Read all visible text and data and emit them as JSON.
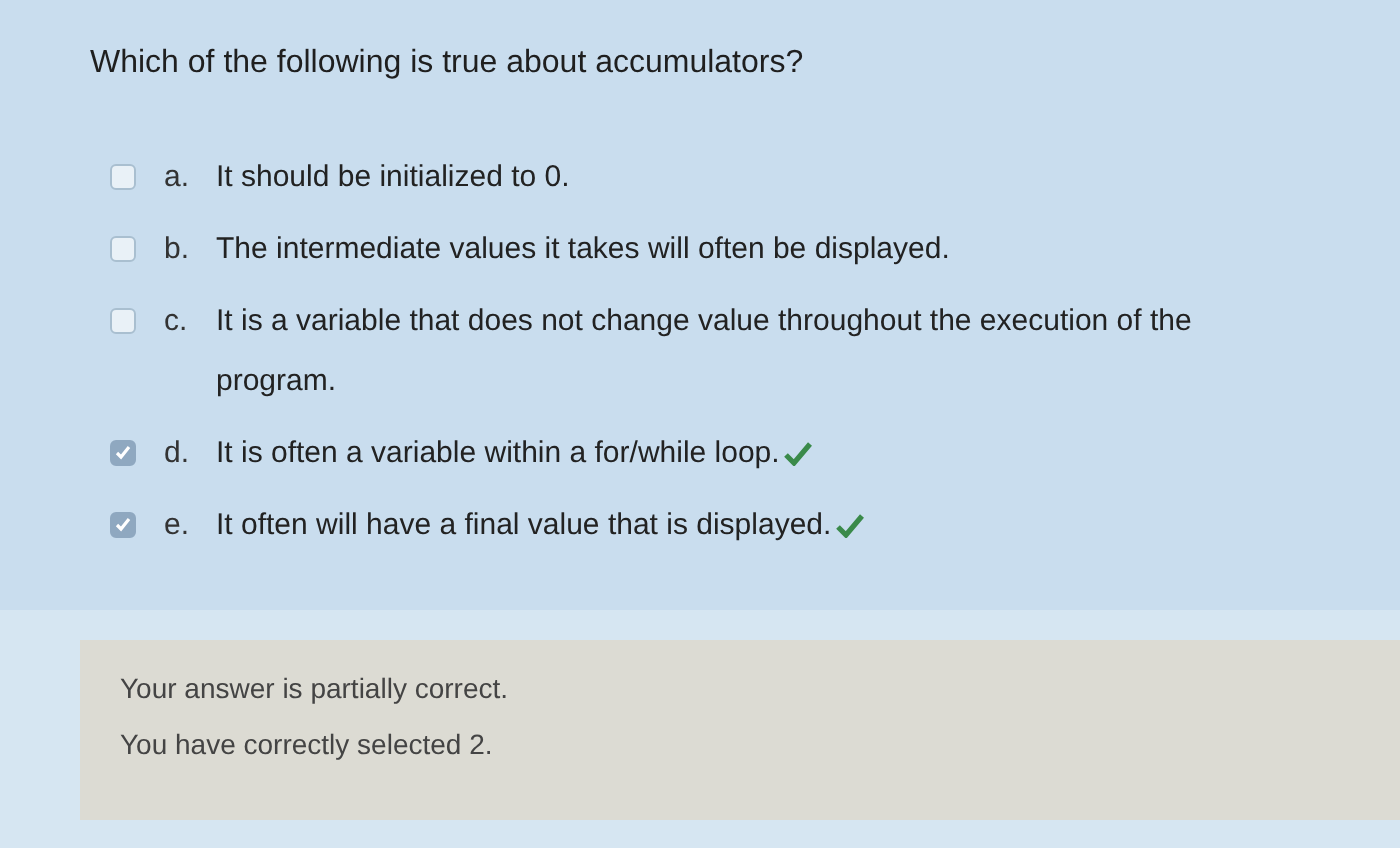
{
  "question": "Which of the following is true about accumulators?",
  "options": [
    {
      "letter": "a.",
      "text": "It should be initialized to 0.",
      "checked": false,
      "correct": false
    },
    {
      "letter": "b.",
      "text": "The intermediate values it takes will often be displayed.",
      "checked": false,
      "correct": false
    },
    {
      "letter": "c.",
      "text": "It is a variable that does not change value throughout the execution of the program.",
      "checked": false,
      "correct": false
    },
    {
      "letter": "d.",
      "text": "It is often a variable within a for/while loop.",
      "checked": true,
      "correct": true
    },
    {
      "letter": "e.",
      "text": "It often will have a final value that is displayed.",
      "checked": true,
      "correct": true
    }
  ],
  "feedback": [
    "Your answer is partially correct.",
    "You have correctly selected 2."
  ]
}
